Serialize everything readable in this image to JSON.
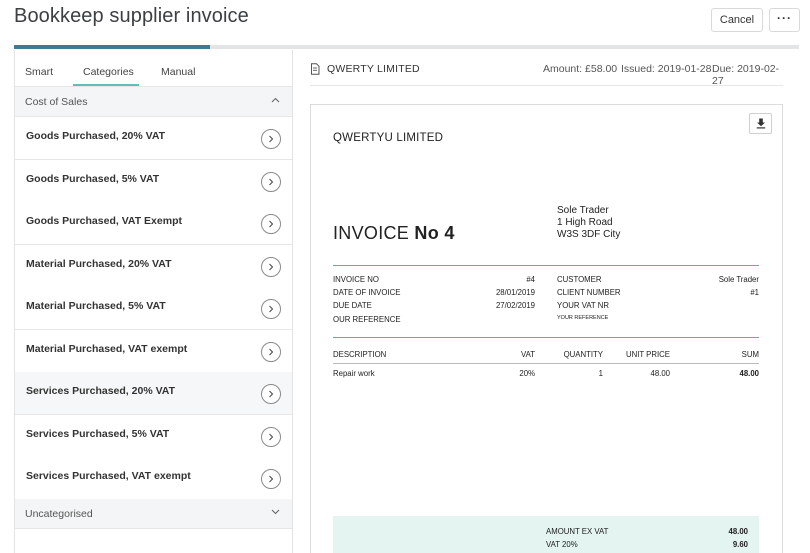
{
  "header": {
    "title": "Bookkeep supplier invoice",
    "cancel_label": "Cancel",
    "more_label": "···",
    "progress_fraction": 0.25
  },
  "tabs": [
    {
      "label": "Smart"
    },
    {
      "label": "Categories",
      "active": true
    },
    {
      "label": "Manual"
    }
  ],
  "groups": {
    "cost_of_sales": "Cost of Sales",
    "uncategorised": "Uncategorised"
  },
  "categories": [
    {
      "label": "Goods Purchased, 20% VAT"
    },
    {
      "label": "Goods Purchased, 5% VAT"
    },
    {
      "label": "Goods Purchased, VAT Exempt"
    },
    {
      "label": "Material Purchased, 20% VAT"
    },
    {
      "label": "Material Purchased, 5% VAT"
    },
    {
      "label": "Material Purchased, VAT exempt"
    },
    {
      "label": "Services Purchased, 20% VAT"
    },
    {
      "label": "Services Purchased, 5% VAT"
    },
    {
      "label": "Services Purchased, VAT exempt"
    }
  ],
  "invoice_header": {
    "supplier": "QWERTY LIMITED",
    "amount": "Amount: £58.00",
    "issued": "Issued: 2019-01-28",
    "due": "Due: 2019-02-27"
  },
  "document": {
    "company": "QWERTYU LIMITED",
    "address": [
      "Sole Trader",
      "1 High Road",
      "W3S 3DF City"
    ],
    "title_prefix": "INVOICE ",
    "title_number": "No 4",
    "details_left": [
      {
        "label": "INVOICE NO",
        "value": "#4"
      },
      {
        "label": "DATE OF INVOICE",
        "value": "28/01/2019"
      },
      {
        "label": "DUE DATE",
        "value": "27/02/2019"
      },
      {
        "label": "OUR REFERENCE",
        "value": ""
      }
    ],
    "details_right": [
      {
        "label": "CUSTOMER",
        "value": "Sole Trader"
      },
      {
        "label": "CLIENT NUMBER",
        "value": "#1"
      },
      {
        "label": "YOUR VAT NR",
        "value": ""
      },
      {
        "label": "YOUR REFERENCE",
        "value": ""
      }
    ],
    "columns": {
      "description": "DESCRIPTION",
      "vat": "VAT",
      "quantity": "QUANTITY",
      "unit_price": "UNIT PRICE",
      "sum": "SUM"
    },
    "line_items": [
      {
        "description": "Repair work",
        "vat": "20%",
        "quantity": "1",
        "unit_price": "48.00",
        "sum": "48.00"
      }
    ],
    "totals": [
      {
        "label": "AMOUNT EX VAT",
        "value": "48.00"
      },
      {
        "label": "VAT 20%",
        "value": "9.60"
      }
    ]
  },
  "colors": {
    "accent": "#5cc0b5",
    "progress": "#3a7c92",
    "totals_bg": "#e3f4f1"
  }
}
